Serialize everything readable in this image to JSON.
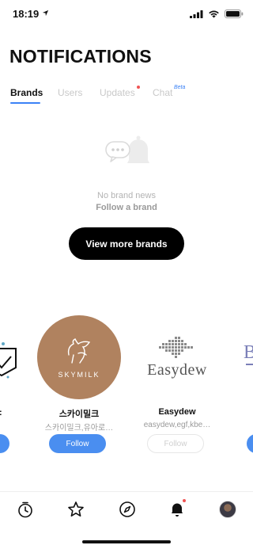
{
  "status_bar": {
    "time": "18:19"
  },
  "header": {
    "title": "NOTIFICATIONS"
  },
  "tabs": [
    {
      "label": "Brands",
      "active": true
    },
    {
      "label": "Users",
      "active": false
    },
    {
      "label": "Updates",
      "active": false,
      "has_dot": true
    },
    {
      "label": "Chat",
      "active": false,
      "badge": "Beta"
    }
  ],
  "empty_state": {
    "line1": "No brand news",
    "line2": "Follow a brand",
    "cta_label": "View more brands"
  },
  "brands": [
    {
      "name": "스카이밀크",
      "tags": "스카이밀크,유아로…",
      "follow_label": "Follow",
      "logo_text": "SKYMILK",
      "logo_bg": "#b0825f",
      "follow_state": "enabled"
    },
    {
      "name": "Easydew",
      "tags": "easydew,egf,kbe…",
      "follow_label": "Follow",
      "logo_text": "Easydew",
      "logo_bg": "#ffffff",
      "follow_state": "disabled"
    }
  ],
  "bottom_nav": [
    {
      "icon": "timer-icon"
    },
    {
      "icon": "star-icon"
    },
    {
      "icon": "compass-icon"
    },
    {
      "icon": "bell-icon",
      "active": true,
      "has_dot": true
    },
    {
      "icon": "avatar"
    }
  ],
  "colors": {
    "accent": "#3b82f6",
    "follow_button": "#4a8ef0",
    "notification_dot": "#f05454",
    "cta_background": "#000000",
    "skymilk_brown": "#b0825f"
  }
}
